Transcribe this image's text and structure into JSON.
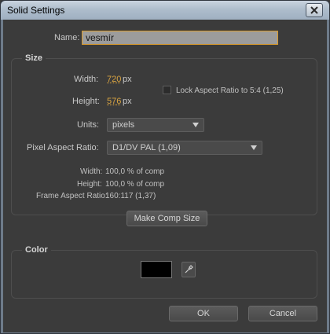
{
  "window": {
    "title": "Solid Settings"
  },
  "name_field": {
    "label": "Name:",
    "value": "vesmír"
  },
  "size": {
    "title": "Size",
    "width_label": "Width:",
    "width_value": "720",
    "width_unit": "px",
    "height_label": "Height:",
    "height_value": "576",
    "height_unit": "px",
    "lock_label": "Lock Aspect Ratio to 5:4 (1,25)",
    "lock_checked": false,
    "units_label": "Units:",
    "units_value": "pixels",
    "par_label": "Pixel Aspect Ratio:",
    "par_value": "D1/DV PAL (1,09)",
    "info_width_label": "Width:",
    "info_width_value": "100,0 % of comp",
    "info_height_label": "Height:",
    "info_height_value": "100,0 % of comp",
    "info_far_label": "Frame Aspect Ratio:",
    "info_far_value": "160:117 (1,37)",
    "make_comp_size": "Make Comp Size"
  },
  "color": {
    "title": "Color",
    "swatch_color": "#000000"
  },
  "footer": {
    "ok": "OK",
    "cancel": "Cancel"
  }
}
